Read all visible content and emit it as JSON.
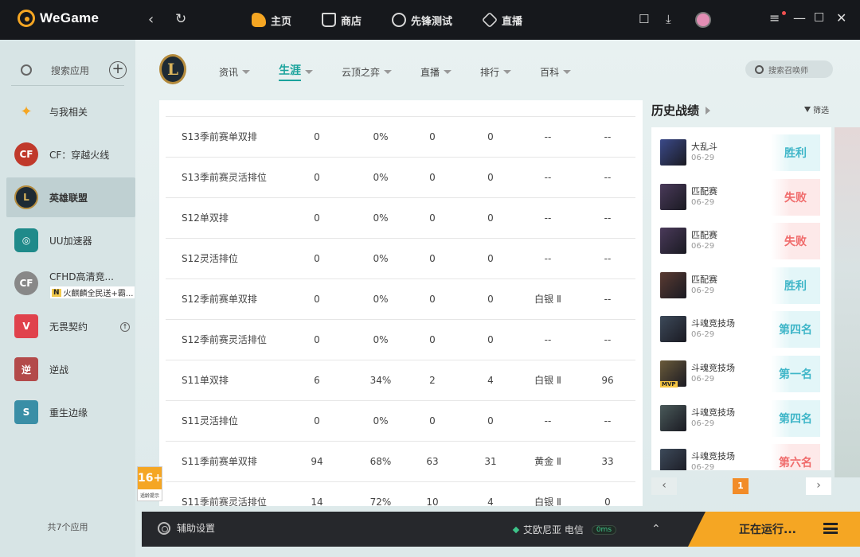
{
  "app": {
    "brand": "WeGame"
  },
  "topnav": [
    {
      "label": "主页",
      "icon": "home-icon"
    },
    {
      "label": "商店",
      "icon": "shop-icon"
    },
    {
      "label": "先锋测试",
      "icon": "pioneer-test-icon"
    },
    {
      "label": "直播",
      "icon": "live-icon"
    }
  ],
  "sidebar": {
    "search_placeholder": "搜索应用",
    "items": [
      {
        "label": "与我相关",
        "color": "#f5a623"
      },
      {
        "label": "CF：穿越火线",
        "color": "#c0392b"
      },
      {
        "label": "英雄联盟",
        "color": "#1d2a34"
      },
      {
        "label": "UU加速器",
        "color": "#1f8a8a"
      },
      {
        "label": "CFHD高清竞...",
        "sub": "火麒麟全民送+霸...",
        "sub_badge": "N",
        "color": "#888888"
      },
      {
        "label": "无畏契约",
        "color": "#e0424c"
      },
      {
        "label": "逆战",
        "color": "#b34a4a"
      },
      {
        "label": "重生边缘",
        "color": "#3a8ea6"
      }
    ],
    "app_count": "共7个应用"
  },
  "game": {
    "logo_letter": "L"
  },
  "subnav": [
    {
      "label": "资讯"
    },
    {
      "label": "生涯",
      "active": true
    },
    {
      "label": "云顶之弈"
    },
    {
      "label": "直播"
    },
    {
      "label": "排行"
    },
    {
      "label": "百科"
    }
  ],
  "summoner_search": {
    "placeholder": "搜索召唤师"
  },
  "table": {
    "rows": [
      [
        "S13季前赛单双排",
        "0",
        "0%",
        "0",
        "0",
        "--",
        "--"
      ],
      [
        "S13季前赛灵活排位",
        "0",
        "0%",
        "0",
        "0",
        "--",
        "--"
      ],
      [
        "S12单双排",
        "0",
        "0%",
        "0",
        "0",
        "--",
        "--"
      ],
      [
        "S12灵活排位",
        "0",
        "0%",
        "0",
        "0",
        "--",
        "--"
      ],
      [
        "S12季前赛单双排",
        "0",
        "0%",
        "0",
        "0",
        "白银 Ⅱ",
        "--"
      ],
      [
        "S12季前赛灵活排位",
        "0",
        "0%",
        "0",
        "0",
        "--",
        "--"
      ],
      [
        "S11单双排",
        "6",
        "34%",
        "2",
        "4",
        "白银 Ⅱ",
        "96"
      ],
      [
        "S11灵活排位",
        "0",
        "0%",
        "0",
        "0",
        "--",
        "--"
      ],
      [
        "S11季前赛单双排",
        "94",
        "68%",
        "63",
        "31",
        "黄金 Ⅱ",
        "33"
      ],
      [
        "S11季前赛灵活排位",
        "14",
        "72%",
        "10",
        "4",
        "白银 Ⅱ",
        "0"
      ]
    ]
  },
  "history": {
    "title": "历史战绩",
    "filter_label": "筛选",
    "items": [
      {
        "mode": "大乱斗",
        "date": "06-29",
        "result": "胜利",
        "kind": "win",
        "color": "#3b4a8a"
      },
      {
        "mode": "匹配赛",
        "date": "06-29",
        "result": "失败",
        "kind": "lose",
        "color": "#4a3a5a"
      },
      {
        "mode": "匹配赛",
        "date": "06-29",
        "result": "失败",
        "kind": "lose",
        "color": "#4a3a5a"
      },
      {
        "mode": "匹配赛",
        "date": "06-29",
        "result": "胜利",
        "kind": "win",
        "color": "#5a3b32"
      },
      {
        "mode": "斗魂竞技场",
        "date": "06-29",
        "result": "第四名",
        "kind": "win",
        "color": "#3d4a5a"
      },
      {
        "mode": "斗魂竞技场",
        "date": "06-29",
        "result": "第一名",
        "kind": "win",
        "color": "#6a5a3a",
        "mvp": "MVP"
      },
      {
        "mode": "斗魂竞技场",
        "date": "06-29",
        "result": "第四名",
        "kind": "win",
        "color": "#4a5a5a"
      },
      {
        "mode": "斗魂竞技场",
        "date": "06-29",
        "result": "第六名",
        "kind": "lose",
        "color": "#3d4a5a"
      }
    ],
    "page": "1"
  },
  "age_rating": {
    "label": "16+",
    "tip": "适龄提示"
  },
  "bottombar": {
    "assist_label": "辅助设置",
    "server": "艾欧尼亚 电信",
    "ping": "0ms",
    "running": "正在运行..."
  }
}
